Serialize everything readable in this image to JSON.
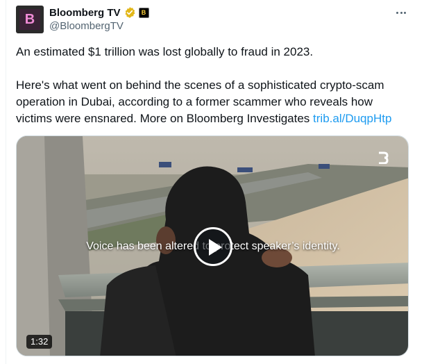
{
  "post": {
    "author": {
      "display_name": "Bloomberg TV",
      "handle": "@BloombergTV",
      "avatar_letter": "B",
      "affiliate_badge": "B",
      "verified_icon": "verified-gold-icon"
    },
    "more_icon": "more-dots-icon",
    "text_line1": "An estimated $1 trillion was lost globally to fraud in 2023.",
    "text_line2": "Here's what went on behind the scenes of a sophisticated crypto-scam",
    "text_line3": "operation in Dubai, according to a former scammer who reveals how",
    "text_line4_prefix": "victims were ensnared. More on Bloomberg Investigates ",
    "link_text": "trib.al/DuqpHtp",
    "video": {
      "caption": "Voice has been altered to protect speaker’s identity.",
      "duration": "1:32",
      "play_icon": "play-icon"
    }
  },
  "colors": {
    "text": "#0f1419",
    "secondary": "#536471",
    "link": "#1d9bf0",
    "verified": "#e2b719"
  }
}
